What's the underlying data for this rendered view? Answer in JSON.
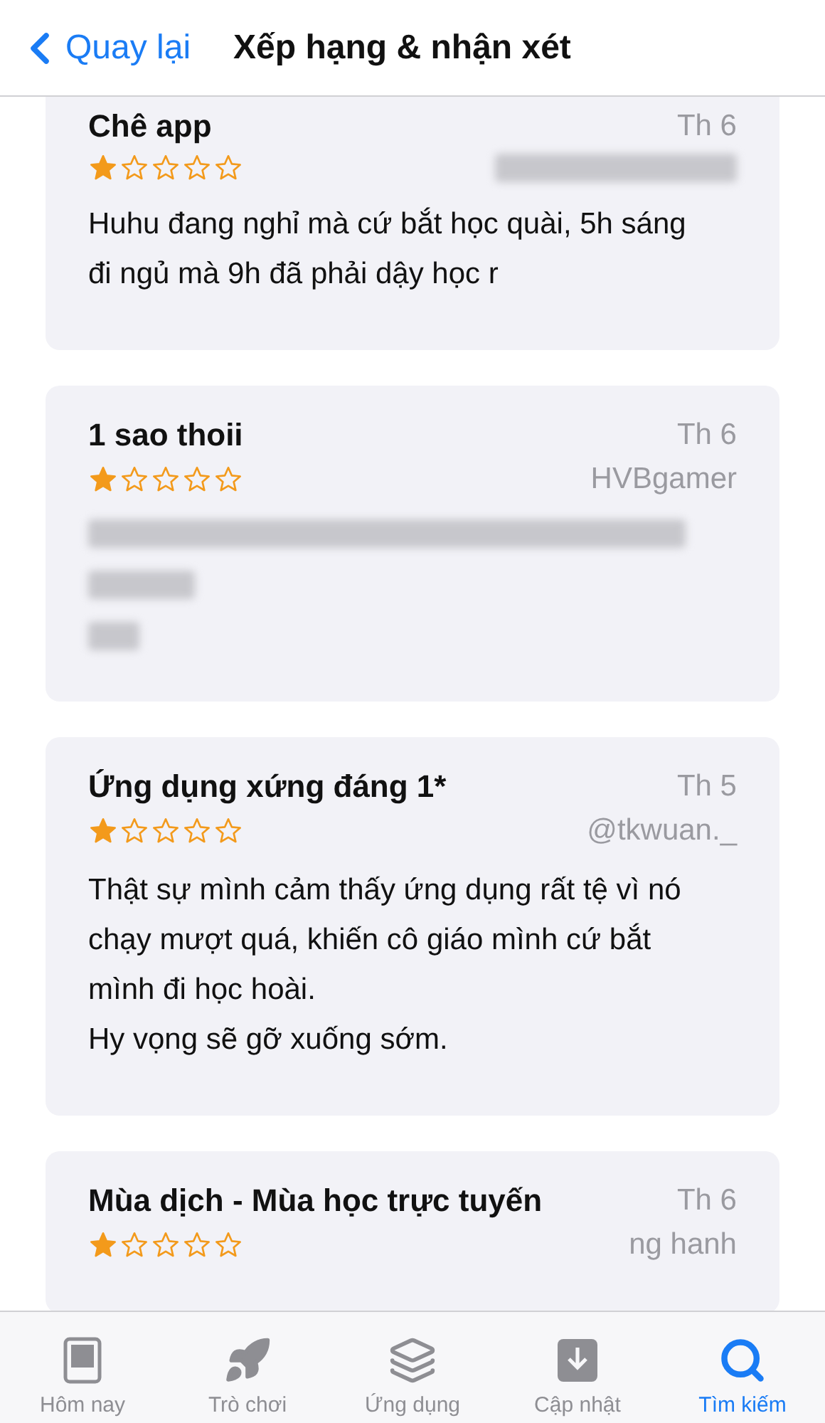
{
  "header": {
    "back": "Quay lại",
    "title": "Xếp hạng & nhận xét"
  },
  "reviews": [
    {
      "title": "Chê app",
      "date": "Th 6",
      "stars": 1,
      "author_redacted": true,
      "body": [
        "Huhu đang nghỉ mà cứ bắt học quài, 5h sáng đi ngủ mà 9h đã phải dậy học r"
      ],
      "body_redacted": false
    },
    {
      "title": "1 sao thoii",
      "date": "Th 6",
      "stars": 1,
      "author": "HVBgamer",
      "author_redacted": false,
      "body_redacted": true
    },
    {
      "title": "Ứng dụng xứng đáng 1*",
      "date": "Th 5",
      "stars": 1,
      "author": "@tkwuan._",
      "author_redacted": false,
      "body": [
        "Thật sự mình cảm thấy ứng dụng rất tệ vì nó chạy mượt quá, khiến cô giáo mình cứ bắt mình đi học hoài.",
        "Hy vọng sẽ gỡ xuống sớm."
      ],
      "body_redacted": false
    },
    {
      "title": "Mùa dịch - Mùa học trực tuyến",
      "date": "Th 6",
      "stars": 1,
      "author": "ng hanh",
      "author_redacted": false,
      "body_redacted": false
    }
  ],
  "tab_bar": [
    {
      "kind": "today",
      "label": "Hôm nay",
      "selected": false
    },
    {
      "kind": "games",
      "label": "Trò chơi",
      "selected": false
    },
    {
      "kind": "apps",
      "label": "Ứng dụng",
      "selected": false
    },
    {
      "kind": "updates",
      "label": "Cập nhật",
      "selected": false
    },
    {
      "kind": "search",
      "label": "Tìm kiếm",
      "selected": true
    }
  ]
}
